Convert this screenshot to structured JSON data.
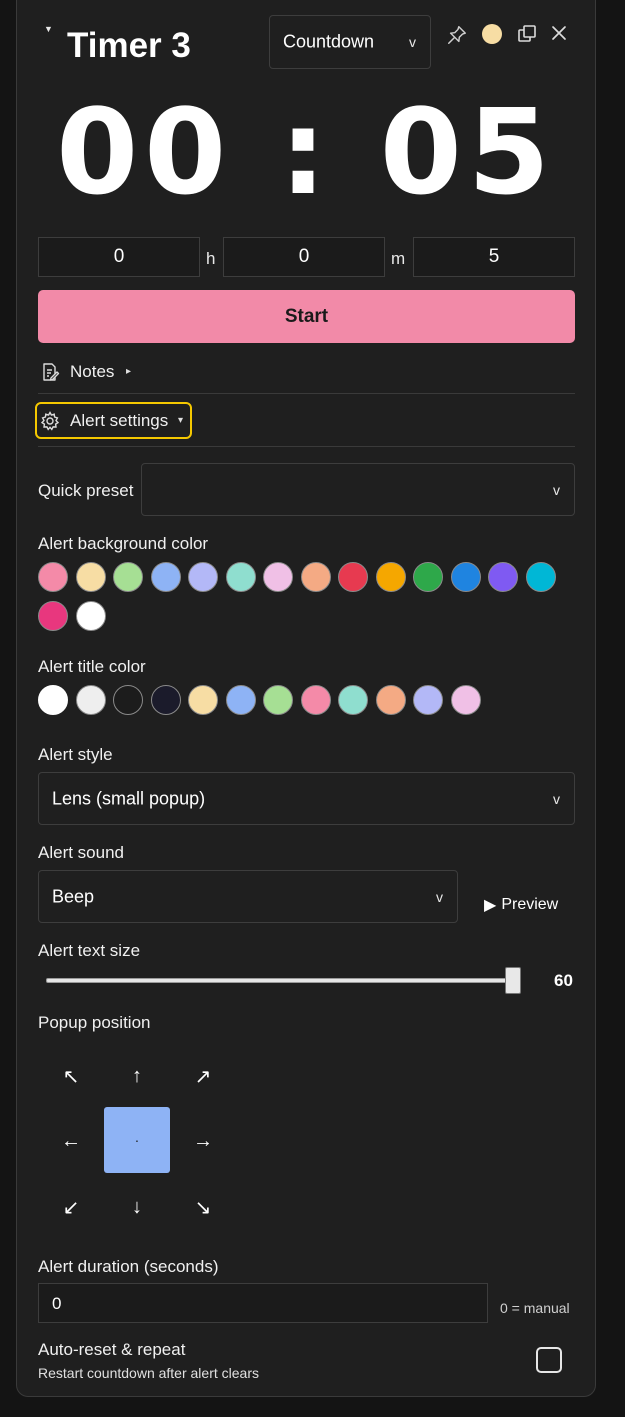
{
  "window": {
    "title": "Timer 3",
    "mode": "Countdown",
    "theme_dot_color": "#f7dda4",
    "icons": [
      "pin-icon",
      "theme-dot-icon",
      "popout-icon",
      "close-icon"
    ]
  },
  "display": {
    "time": "00:05",
    "hours_part": "00",
    "separator": ":",
    "seconds_part": "05"
  },
  "duration_inputs": {
    "hours": "0",
    "hours_unit": "h",
    "minutes": "0",
    "minutes_unit": "m",
    "seconds": "5"
  },
  "start_button": {
    "label": "Start",
    "color": "#f28aa8"
  },
  "notes": {
    "label": "Notes",
    "caret": "▸"
  },
  "alert_settings": {
    "label": "Alert settings",
    "caret": "▾",
    "highlight_color": "#f5c800",
    "quick_preset": {
      "label": "Quick preset",
      "value": ""
    },
    "background_color": {
      "label": "Alert background color",
      "swatches": [
        "#f48aa8",
        "#f7dda4",
        "#a6df94",
        "#8eb3f5",
        "#b3b8f7",
        "#8fdecf",
        "#f0c0e6",
        "#f4aa84",
        "#e73a50",
        "#f5a700",
        "#2ea84a",
        "#1f84e0",
        "#7f5af2",
        "#00b7d6",
        "#e8377e",
        "#ffffff"
      ]
    },
    "title_color": {
      "label": "Alert title color",
      "swatches": [
        "#ffffff",
        "#eeeeee",
        "#1c1c1c",
        "#1b1b2b",
        "#f7dda4",
        "#8eb3f5",
        "#a6df94",
        "#f48aa8",
        "#8fdecf",
        "#f4aa84",
        "#b3b8f7",
        "#f0c0e6"
      ]
    },
    "style": {
      "label": "Alert style",
      "value": "Lens (small popup)"
    },
    "sound": {
      "label": "Alert sound",
      "value": "Beep",
      "preview_label": "Preview",
      "preview_icon": "▶"
    },
    "text_size": {
      "label": "Alert text size",
      "value": "60",
      "fraction": 1.0
    },
    "popup_position": {
      "label": "Popup position",
      "arrows": {
        "nw": "↖",
        "n": "↑",
        "ne": "↗",
        "w": "←",
        "center": "·",
        "e": "→",
        "sw": "↙",
        "s": "↓",
        "se": "↘"
      },
      "selected": "center",
      "selected_color": "#8eb3f5"
    },
    "duration": {
      "label": "Alert duration (seconds)",
      "value": "0",
      "hint": "0 = manual"
    },
    "auto_reset": {
      "label": "Auto-reset & repeat",
      "description": "Restart countdown after alert clears",
      "checked": false
    }
  }
}
